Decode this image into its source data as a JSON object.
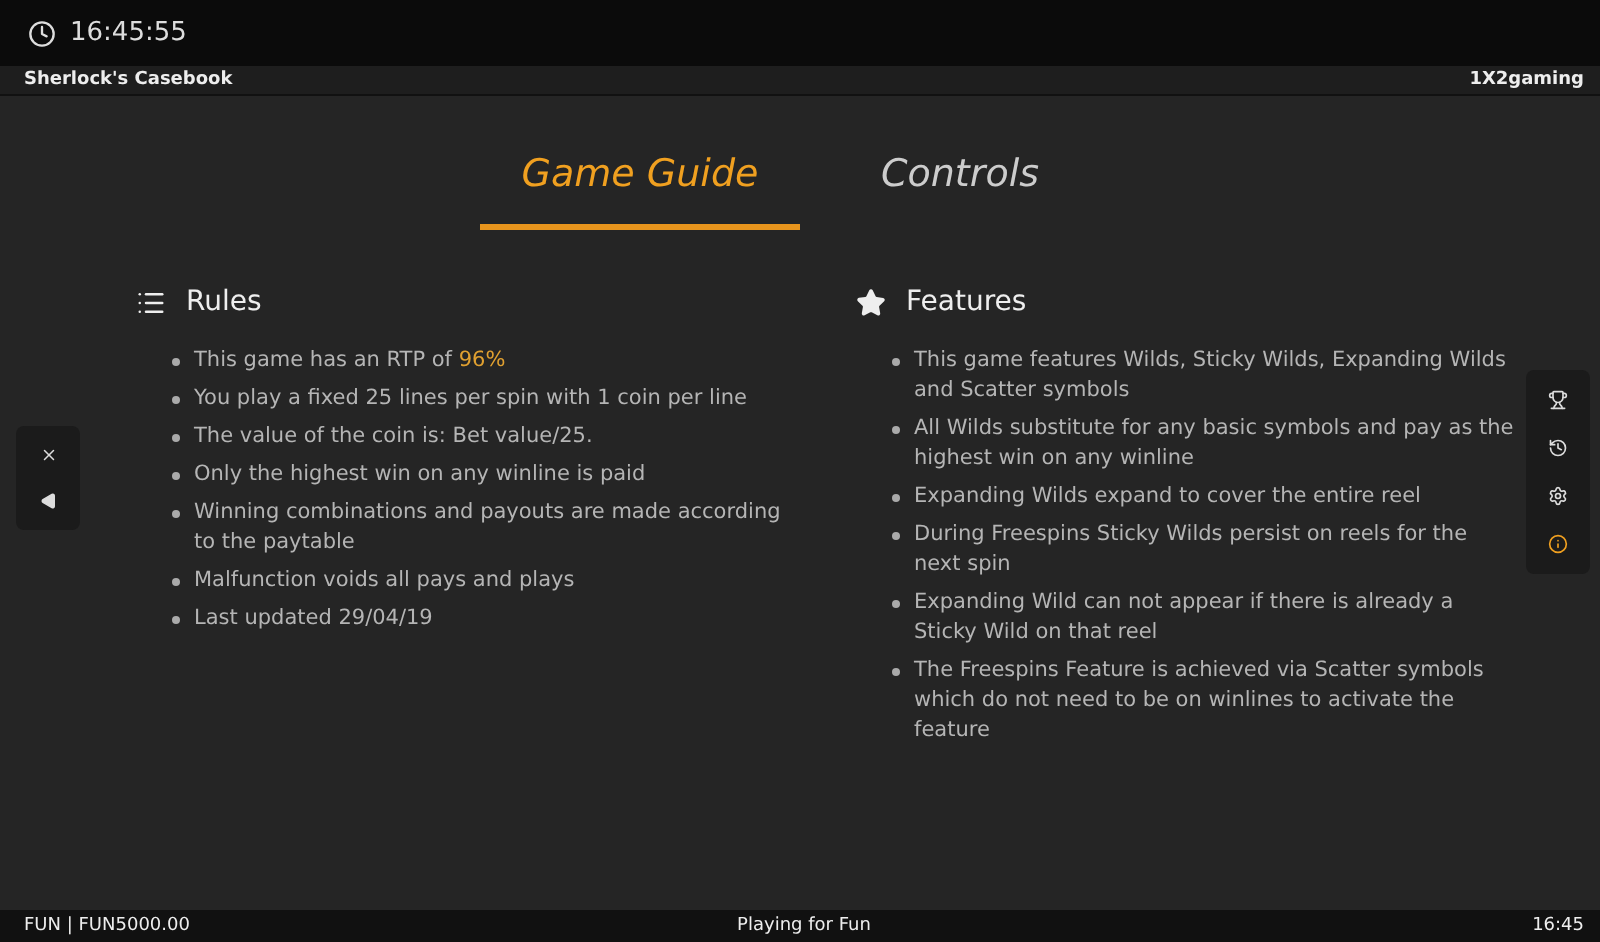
{
  "status_bar": {
    "time": "16:45:55"
  },
  "title_bar": {
    "title": "Sherlock's Casebook",
    "brand": "1X2gaming"
  },
  "tabs": [
    {
      "label": "Game Guide",
      "selected": true
    },
    {
      "label": "Controls",
      "selected": false
    }
  ],
  "left_panel": [
    {
      "kind": "close"
    },
    {
      "kind": "back"
    }
  ],
  "right_panel": [
    {
      "kind": "trophy",
      "selected": false
    },
    {
      "kind": "history",
      "selected": false
    },
    {
      "kind": "settings",
      "selected": false
    },
    {
      "kind": "info",
      "selected": true
    }
  ],
  "sections": [
    {
      "kind": "list",
      "title": "Rules",
      "items": [
        {
          "text": "This game has an RTP of ",
          "highlight": "96%"
        },
        {
          "text": "You play a fixed 25 lines per spin with 1 coin per line"
        },
        {
          "text": "The value of the coin is: Bet value/25."
        },
        {
          "text": "Only the highest win on any winline is paid"
        },
        {
          "text": "Winning combinations and payouts are made according to the paytable"
        },
        {
          "text": "Malfunction voids all pays and plays"
        },
        {
          "text": "Last updated 29/04/19"
        }
      ]
    },
    {
      "kind": "star",
      "title": "Features",
      "items": [
        {
          "text": "This game features Wilds, Sticky Wilds, Expanding Wilds and Scatter symbols"
        },
        {
          "text": "All Wilds substitute for any basic symbols and pay as the highest win on any winline"
        },
        {
          "text": "Expanding Wilds expand to cover the entire reel"
        },
        {
          "text": "During Freespins Sticky Wilds persist on reels for the next spin"
        },
        {
          "text": "Expanding Wild can not appear if there is already a Sticky Wild on that reel"
        },
        {
          "text": "The Freespins Feature is achieved via Scatter symbols which do not need to be on winlines to activate the feature"
        }
      ]
    }
  ],
  "footer": {
    "balance": "FUN | FUN5000.00",
    "mode": "Playing for Fun",
    "time": "16:45"
  }
}
